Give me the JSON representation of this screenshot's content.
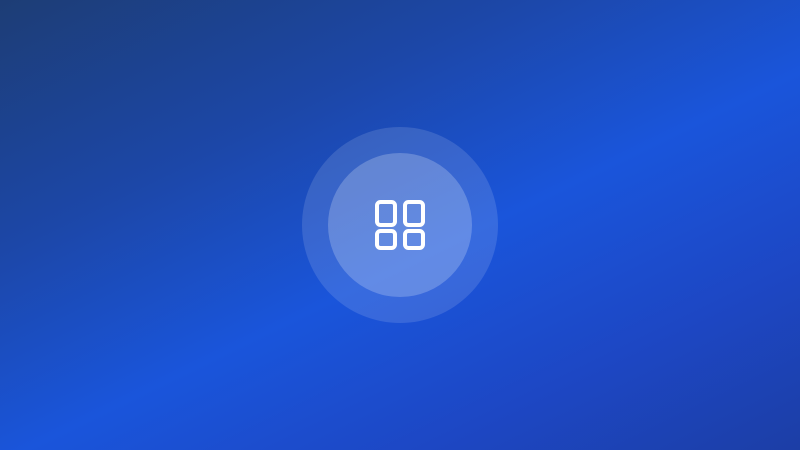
{
  "screen": {
    "background_colors": [
      "#1d3d75",
      "#1a55db",
      "#1c3ea6"
    ]
  },
  "launcher": {
    "icon": "grid-icon",
    "icon_color": "#ffffff"
  }
}
